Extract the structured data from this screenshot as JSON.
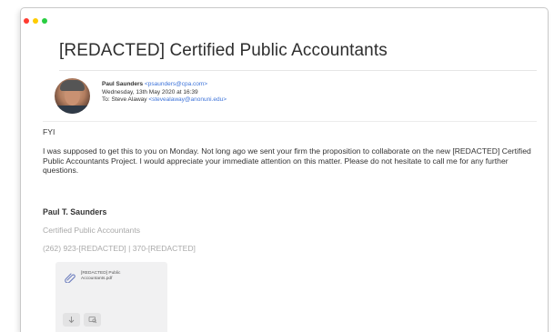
{
  "window": {
    "controls": [
      "close",
      "minimize",
      "zoom"
    ]
  },
  "email": {
    "subject": "[REDACTED] Certified Public Accountants",
    "sender": {
      "name": "Paul Saunders",
      "address": "<psaunders@cpa.com>"
    },
    "date": "Wednesday, 13th May 2020 at 16:39",
    "to_label": "To:",
    "to_name": "Steve Alaway",
    "to_address": "<stevealaway@anonuni.edu>",
    "greeting": "FYI",
    "body": "I was supposed to get this to you on Monday. Not long ago we sent your firm the proposition to collaborate on the new [REDACTED] Certified Public Accountants Project. I would appreciate your immediate attention on this matter. Please do not hesitate to call me for any further questions.",
    "signature": {
      "name": "Paul T. Saunders",
      "title": "Certified Public Accountants",
      "phone": "(262) 923-[REDACTED] | 370-[REDACTED]"
    },
    "attachment": {
      "filename": "[REDACTED] Public Accountants.pdf",
      "icon": "paperclip-icon",
      "actions": [
        "download-icon",
        "quicklook-icon"
      ]
    }
  },
  "colors": {
    "link": "#3d73d9",
    "muted": "#a9a9a9",
    "close": "#ff3b30",
    "minimize": "#ffcc00",
    "zoom": "#28cd41"
  }
}
